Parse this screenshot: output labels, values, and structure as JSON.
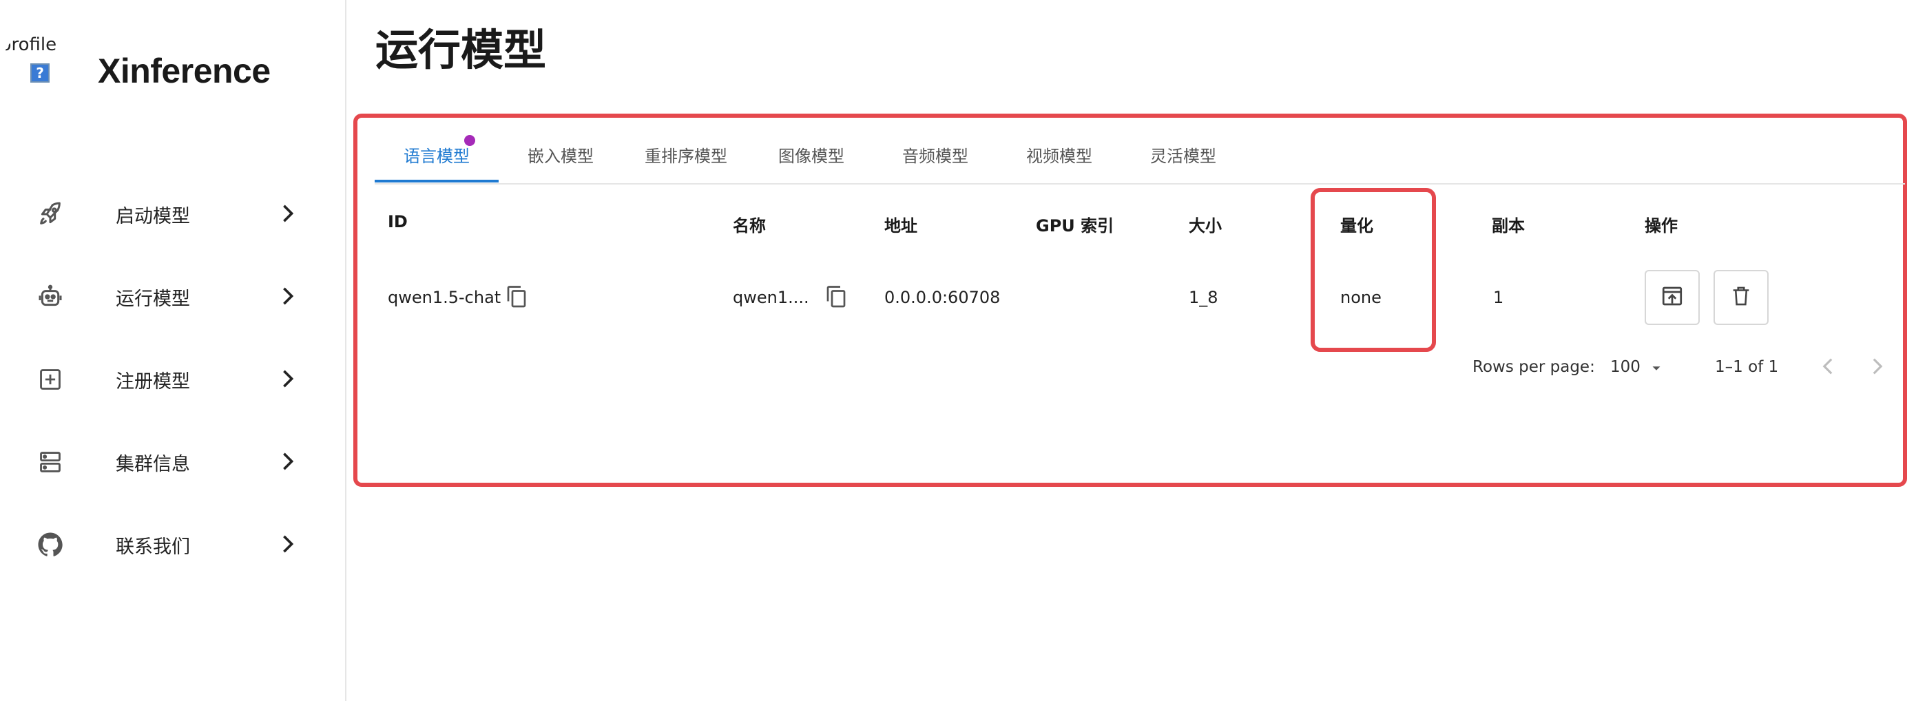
{
  "sidebar": {
    "logo_alt": "profile",
    "broken_image_glyph": "?",
    "brand": "Xinference",
    "items": [
      {
        "label": "启动模型",
        "icon": "rocket-icon"
      },
      {
        "label": "运行模型",
        "icon": "robot-icon"
      },
      {
        "label": "注册模型",
        "icon": "add-box-icon"
      },
      {
        "label": "集群信息",
        "icon": "server-icon"
      },
      {
        "label": "联系我们",
        "icon": "github-icon"
      }
    ]
  },
  "main": {
    "title": "运行模型",
    "tabs": [
      {
        "label": "语言模型",
        "active": true,
        "badge": true
      },
      {
        "label": "嵌入模型"
      },
      {
        "label": "重排序模型"
      },
      {
        "label": "图像模型"
      },
      {
        "label": "音频模型"
      },
      {
        "label": "视频模型"
      },
      {
        "label": "灵活模型"
      }
    ],
    "table": {
      "columns": [
        "ID",
        "名称",
        "地址",
        "GPU 索引",
        "大小",
        "量化",
        "副本",
        "操作"
      ],
      "rows": [
        {
          "id": "qwen1.5-chat",
          "name": "qwen1....",
          "address": "0.0.0.0:60708",
          "gpu_index": "",
          "size": "1_8",
          "quantization": "none",
          "replicas": "1"
        }
      ]
    },
    "pagination": {
      "rows_per_page_label": "Rows per page:",
      "rows_per_page_value": "100",
      "range": "1–1 of 1"
    }
  },
  "colors": {
    "accent": "#1f7ad1",
    "highlight_border": "#e5484d",
    "badge": "#a52ab8"
  }
}
